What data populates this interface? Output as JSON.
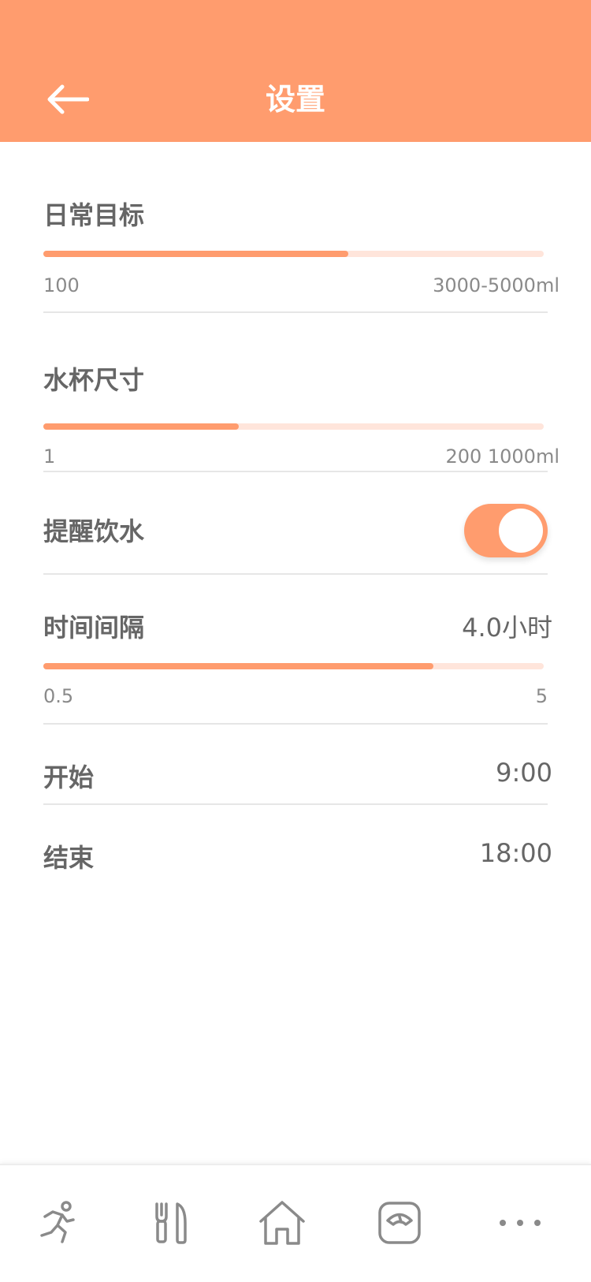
{
  "header": {
    "title": "设置",
    "back_icon": "back-arrow-icon",
    "background": "#FF9C6E"
  },
  "colors": {
    "accent": "#FF9C6E",
    "track": "#FFE5DB"
  },
  "daily_goal": {
    "label": "日常目标",
    "min_label": "100",
    "max_label": "3000-5000ml",
    "fill_fraction": 0.61
  },
  "cup_size": {
    "label": "水杯尺寸",
    "min_label": "1",
    "max_label": "200 1000ml",
    "fill_fraction": 0.39
  },
  "reminder": {
    "label": "提醒饮水",
    "enabled": true
  },
  "interval": {
    "label": "时间间隔",
    "value": "4.0小时",
    "min_label": "0.5",
    "max_label": "5",
    "fill_fraction": 0.78
  },
  "start": {
    "label": "开始",
    "value": "9:00"
  },
  "end": {
    "label": "结束",
    "value": "18:00"
  },
  "bottom_nav": {
    "items": [
      {
        "icon": "running-icon"
      },
      {
        "icon": "fork-knife-icon"
      },
      {
        "icon": "home-icon"
      },
      {
        "icon": "scale-icon"
      },
      {
        "icon": "more-icon"
      }
    ]
  }
}
